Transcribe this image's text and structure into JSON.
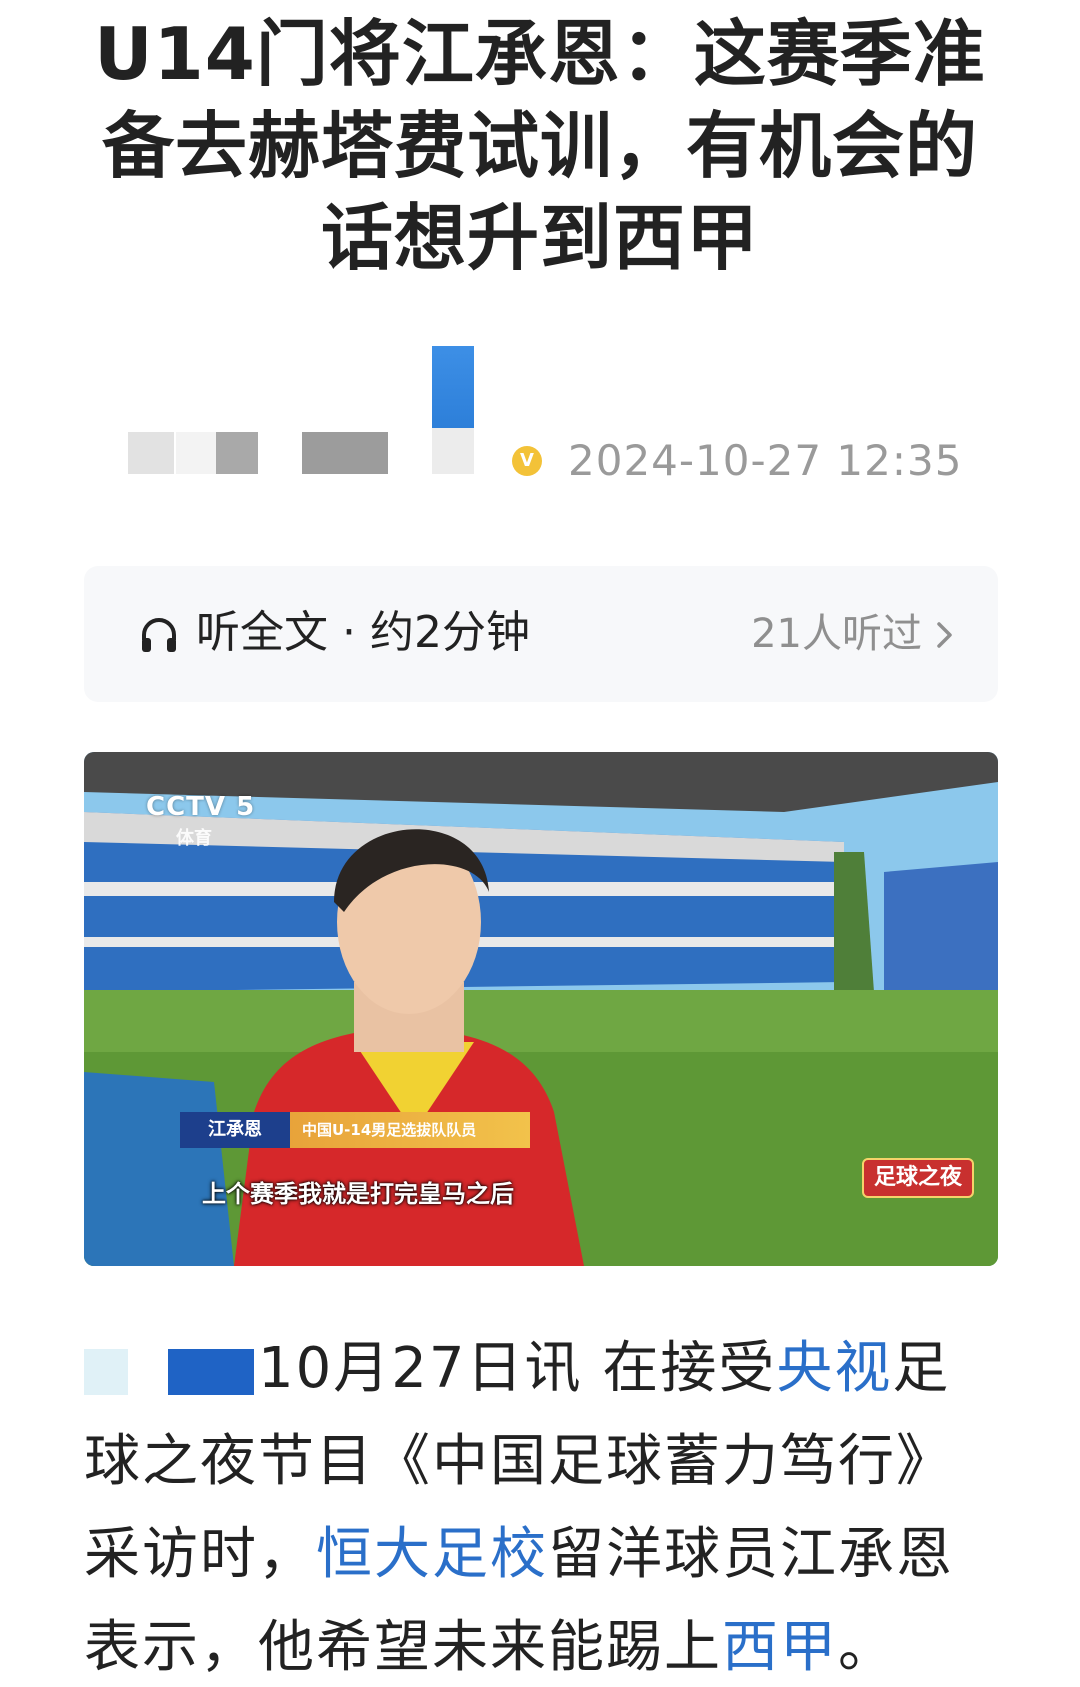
{
  "article": {
    "headline": "U14门将江承恩：这赛季准备去赫塔费试训，有机会的话想升到西甲",
    "timestamp": "2024-10-27  12:35"
  },
  "listen": {
    "label": "听全文 · 约2分钟",
    "count": "21人听过"
  },
  "video": {
    "channel_logo": "CCTV 5",
    "channel_sub": "体育",
    "caption_name": "江承恩",
    "caption_title": "中国U-14男足选拔队队员",
    "subtitle": "上个赛季我就是打完皇马之后",
    "program_logo": "足球之夜"
  },
  "body": {
    "date_text": "10月27日讯 在接受",
    "link_cctv": "央视",
    "text_2": "足球之夜节目《中国足球蓄力笃行》采访时，",
    "link_school": "恒大足校",
    "text_3": "留洋球员江承恩表示，他希望未来能踢上",
    "link_laliga": "西甲",
    "text_4": "。"
  },
  "colors": {
    "link": "#2a6fc9",
    "meta_gray": "#9a9a9a",
    "verify_badge": "#f3c238"
  },
  "icons": [
    "headphone-icon",
    "chevron-right-icon",
    "verified-icon"
  ]
}
